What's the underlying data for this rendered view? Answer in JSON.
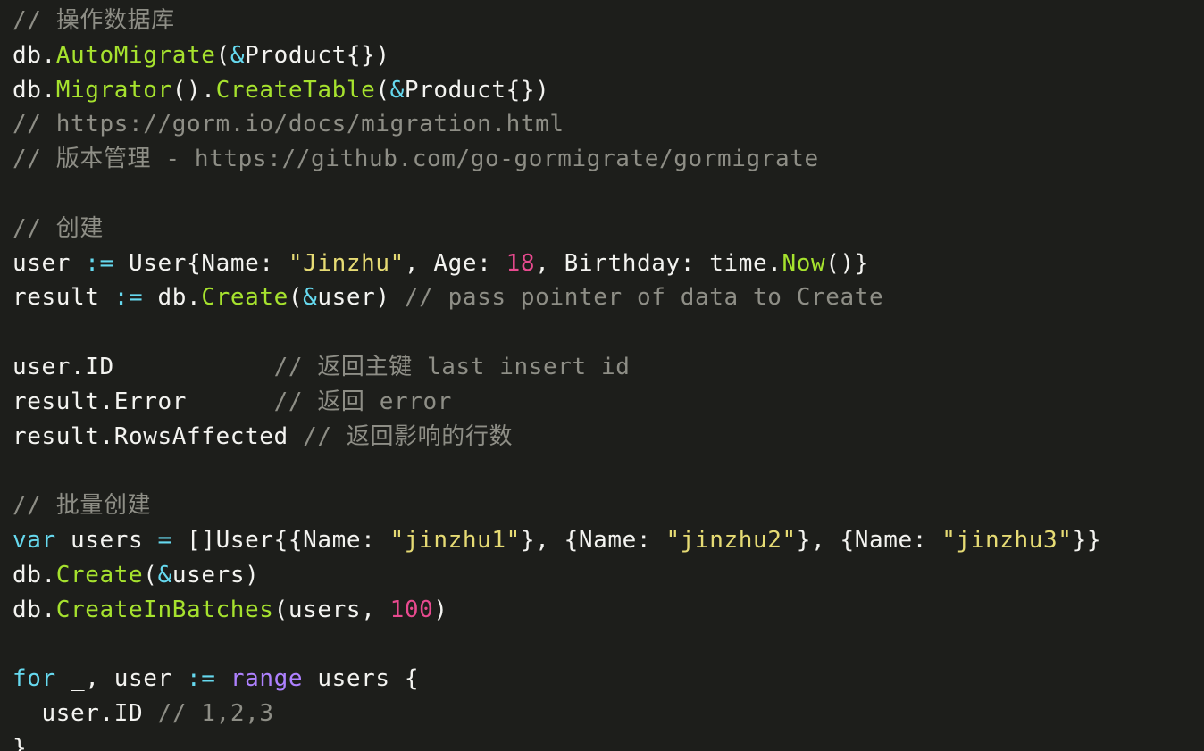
{
  "colors": {
    "background": "#1d1e1b",
    "plain": "#f3f3f0",
    "comment": "#8e8e86",
    "func": "#a6e22e",
    "string": "#e6db74",
    "number": "#e84a8f",
    "keyword": "#66d9ef",
    "op": "#66d9ef",
    "builtin": "#ae81ff"
  },
  "code": {
    "lines": [
      [
        [
          "comment",
          "// 操作数据库"
        ]
      ],
      [
        [
          "plain",
          "db."
        ],
        [
          "func",
          "AutoMigrate"
        ],
        [
          "plain",
          "("
        ],
        [
          "op",
          "&"
        ],
        [
          "plain",
          "Product{})"
        ]
      ],
      [
        [
          "plain",
          "db."
        ],
        [
          "func",
          "Migrator"
        ],
        [
          "plain",
          "()."
        ],
        [
          "func",
          "CreateTable"
        ],
        [
          "plain",
          "("
        ],
        [
          "op",
          "&"
        ],
        [
          "plain",
          "Product{})"
        ]
      ],
      [
        [
          "comment",
          "// https://gorm.io/docs/migration.html"
        ]
      ],
      [
        [
          "comment",
          "// 版本管理 - https://github.com/go-gormigrate/gormigrate"
        ]
      ],
      [],
      [
        [
          "comment",
          "// 创建"
        ]
      ],
      [
        [
          "plain",
          "user "
        ],
        [
          "op",
          ":="
        ],
        [
          "plain",
          " User{Name: "
        ],
        [
          "string",
          "\"Jinzhu\""
        ],
        [
          "plain",
          ", Age: "
        ],
        [
          "number",
          "18"
        ],
        [
          "plain",
          ", Birthday: time."
        ],
        [
          "func",
          "Now"
        ],
        [
          "plain",
          "()}"
        ]
      ],
      [
        [
          "plain",
          "result "
        ],
        [
          "op",
          ":="
        ],
        [
          "plain",
          " db."
        ],
        [
          "func",
          "Create"
        ],
        [
          "plain",
          "("
        ],
        [
          "op",
          "&"
        ],
        [
          "plain",
          "user) "
        ],
        [
          "comment",
          "// pass pointer of data to Create"
        ]
      ],
      [],
      [
        [
          "plain",
          "user.ID           "
        ],
        [
          "comment",
          "// 返回主键 last insert id"
        ]
      ],
      [
        [
          "plain",
          "result.Error      "
        ],
        [
          "comment",
          "// 返回 error"
        ]
      ],
      [
        [
          "plain",
          "result.RowsAffected "
        ],
        [
          "comment",
          "// 返回影响的行数"
        ]
      ],
      [],
      [
        [
          "comment",
          "// 批量创建"
        ]
      ],
      [
        [
          "keyword",
          "var"
        ],
        [
          "plain",
          " users "
        ],
        [
          "op",
          "="
        ],
        [
          "plain",
          " []User{{Name: "
        ],
        [
          "string",
          "\"jinzhu1\""
        ],
        [
          "plain",
          "}, {Name: "
        ],
        [
          "string",
          "\"jinzhu2\""
        ],
        [
          "plain",
          "}, {Name: "
        ],
        [
          "string",
          "\"jinzhu3\""
        ],
        [
          "plain",
          "}}"
        ]
      ],
      [
        [
          "plain",
          "db."
        ],
        [
          "func",
          "Create"
        ],
        [
          "plain",
          "("
        ],
        [
          "op",
          "&"
        ],
        [
          "plain",
          "users)"
        ]
      ],
      [
        [
          "plain",
          "db."
        ],
        [
          "func",
          "CreateInBatches"
        ],
        [
          "plain",
          "(users, "
        ],
        [
          "number",
          "100"
        ],
        [
          "plain",
          ")"
        ]
      ],
      [],
      [
        [
          "keyword",
          "for"
        ],
        [
          "plain",
          " _, user "
        ],
        [
          "op",
          ":="
        ],
        [
          "plain",
          " "
        ],
        [
          "builtin",
          "range"
        ],
        [
          "plain",
          " users {"
        ]
      ],
      [
        [
          "plain",
          "  user.ID "
        ],
        [
          "comment",
          "// 1,2,3"
        ]
      ],
      [
        [
          "plain",
          "}"
        ]
      ]
    ]
  }
}
